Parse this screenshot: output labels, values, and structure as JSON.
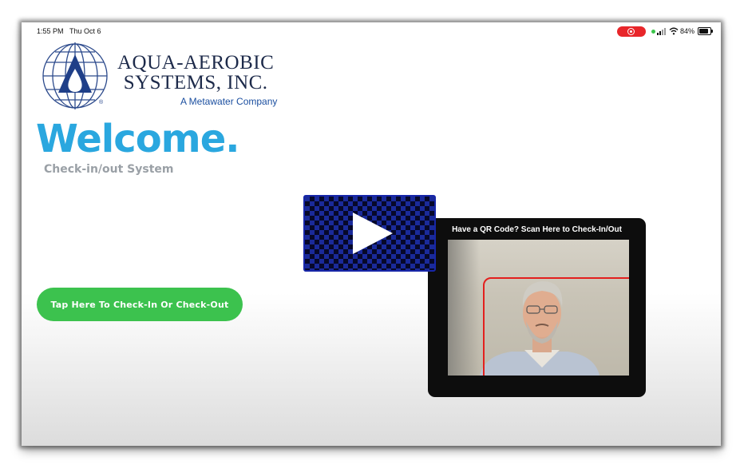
{
  "status_bar": {
    "time": "1:55 PM",
    "date": "Thu Oct 6",
    "battery": "84%"
  },
  "brand": {
    "name_line1": "AQUA-AEROBIC",
    "name_line2": "SYSTEMS, INC.",
    "subtitle": "A Metawater Company",
    "registered_mark": "®"
  },
  "welcome": {
    "title": "Welcome.",
    "subtitle": "Check-in/out System"
  },
  "actions": {
    "checkin_label": "Tap Here To Check-In Or Check-Out"
  },
  "scanner": {
    "title": "Have a QR Code? Scan Here to Check-In/Out"
  },
  "colors": {
    "welcome_blue": "#2aa7df",
    "button_green": "#3cc24e",
    "scan_frame_red": "#e3201e",
    "record_red": "#e8262a"
  },
  "icons": [
    "record-icon",
    "signal-icon",
    "wifi-icon",
    "battery-icon",
    "globe-logo-icon",
    "play-icon"
  ]
}
